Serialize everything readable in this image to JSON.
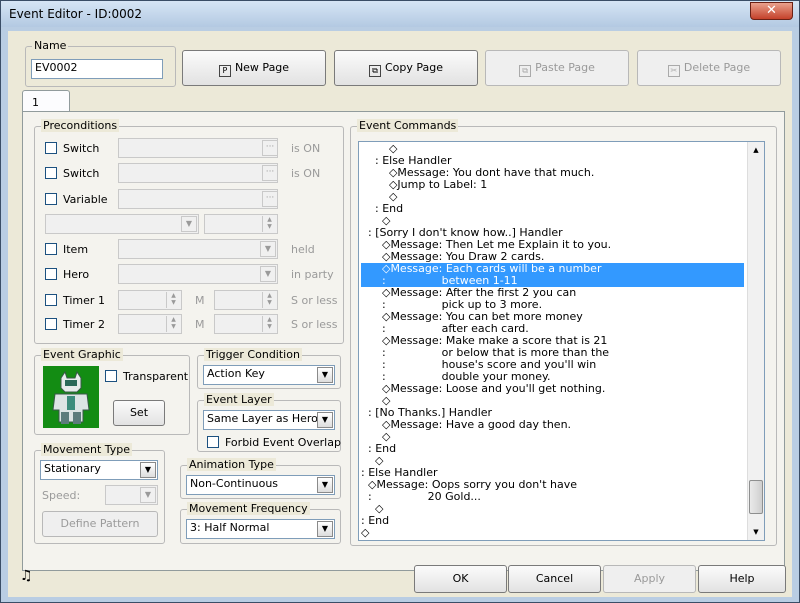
{
  "window": {
    "title": "Event Editor - ID:0002",
    "close_glyph": "✕"
  },
  "name": {
    "label": "Name",
    "value": "EV0002"
  },
  "page_buttons": {
    "new": "New Page",
    "copy": "Copy Page",
    "paste": "Paste Page",
    "delete": "Delete Page"
  },
  "page_tab": "1",
  "preconditions": {
    "label": "Preconditions",
    "switch1": "Switch",
    "switch2": "Switch",
    "is_on1": "is ON",
    "is_on2": "is ON",
    "variable": "Variable",
    "item": "Item",
    "held": "held",
    "hero": "Hero",
    "in_party": "in party",
    "timer1": "Timer 1",
    "timer2": "Timer 2",
    "m1": "M",
    "m2": "M",
    "sorless1": "S or less",
    "sorless2": "S or less",
    "dots": "···"
  },
  "event_graphic": {
    "label": "Event Graphic",
    "transparent": "Transparent",
    "set": "Set"
  },
  "trigger": {
    "label": "Trigger Condition",
    "value": "Action Key"
  },
  "event_layer": {
    "label": "Event Layer",
    "value": "Same Layer as Hero",
    "forbid": "Forbid Event Overlap"
  },
  "movement_type": {
    "label": "Movement Type",
    "value": "Stationary",
    "speed": "Speed:",
    "define": "Define Pattern"
  },
  "animation_type": {
    "label": "Animation Type",
    "value": "Non-Continuous"
  },
  "movement_freq": {
    "label": "Movement Frequency",
    "value": "3: Half Normal"
  },
  "event_commands": {
    "label": "Event Commands",
    "lines": [
      "        ◇",
      "    : Else Handler",
      "        ◇Message: You dont have that much.",
      "        ◇Jump to Label: 1",
      "        ◇",
      "    : End",
      "      ◇",
      "  : [Sorry I don't know how..] Handler",
      "      ◇Message: Then Let me Explain it to you.",
      "      ◇Message: You Draw 2 cards.",
      "      ◇Message: Each cards will be a number",
      "      :                between 1-11",
      "      ◇Message: After the first 2 you can",
      "      :                pick up to 3 more.",
      "      ◇Message: You can bet more money",
      "      :                after each card.",
      "      ◇Message: Make make a score that is 21",
      "      :                or below that is more than the",
      "      :                house's score and you'll win",
      "      :                double your money.",
      "      ◇Message: Loose and you'll get nothing.",
      "      ◇",
      "  : [No Thanks.] Handler",
      "      ◇Message: Have a good day then.",
      "      ◇",
      "  : End",
      "    ◇",
      ": Else Handler",
      "  ◇Message: Oops sorry you don't have",
      "  :                20 Gold...",
      "    ◇",
      ": End",
      "◇"
    ]
  },
  "footer": {
    "ok": "OK",
    "cancel": "Cancel",
    "apply": "Apply",
    "help": "Help"
  },
  "icons": {
    "music": "♫",
    "new": "P",
    "copy": "⧉",
    "paste": "⧉",
    "delete": "✂"
  },
  "colors": {
    "selection": "#3399ff",
    "dialog_bg": "#ece9d8"
  }
}
